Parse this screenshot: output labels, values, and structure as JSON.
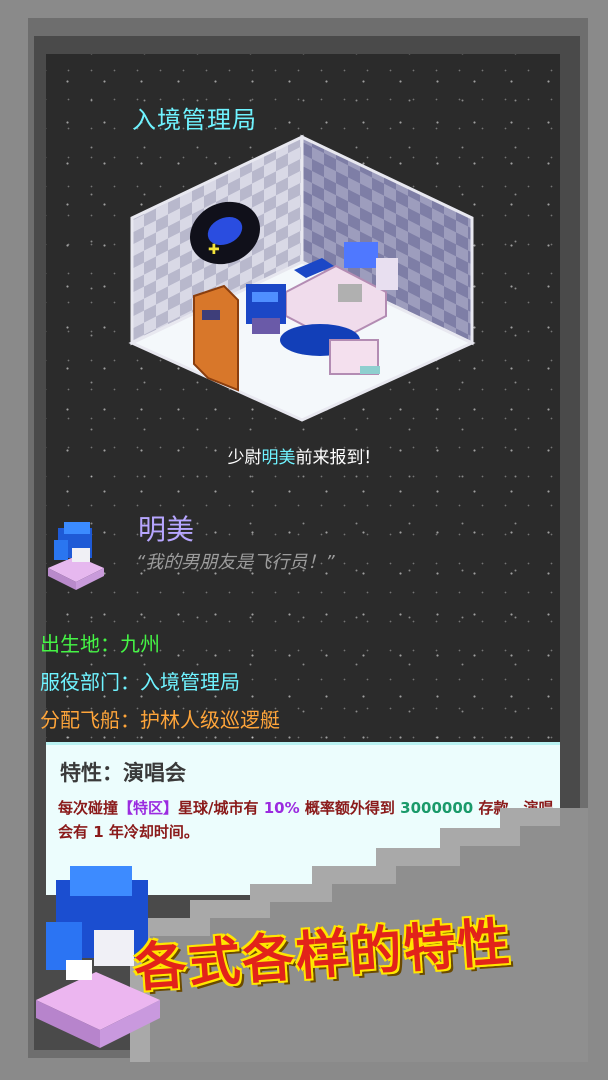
{
  "room": {
    "title": "入境管理局"
  },
  "report": {
    "prefix": "少尉",
    "name": "明美",
    "suffix": "前来报到！"
  },
  "character": {
    "name": "明美",
    "quote": "“我的男朋友是飞行员！”",
    "birth": "出生地：九州",
    "department": "服役部门：入境管理局",
    "ship": "分配飞船：护林人级巡逻艇"
  },
  "trait": {
    "title": "特性：演唱会",
    "desc_1": "每次碰撞",
    "desc_tag": "【特区】",
    "desc_2": "星球/城市有",
    "desc_pct": "10%",
    "desc_3": "概率额外得到",
    "desc_amount": "3000000",
    "desc_4": "存款。演唱会有 1 年冷却时间。"
  },
  "slogan": "各式各样的特性",
  "colors": {
    "accent_cyan": "#6ff3ff",
    "name_purple": "#b7a6ff",
    "birth_green": "#45f545",
    "ship_orange": "#ffa53a",
    "slogan_red": "#e2231a",
    "slogan_outline": "#ffe600"
  }
}
